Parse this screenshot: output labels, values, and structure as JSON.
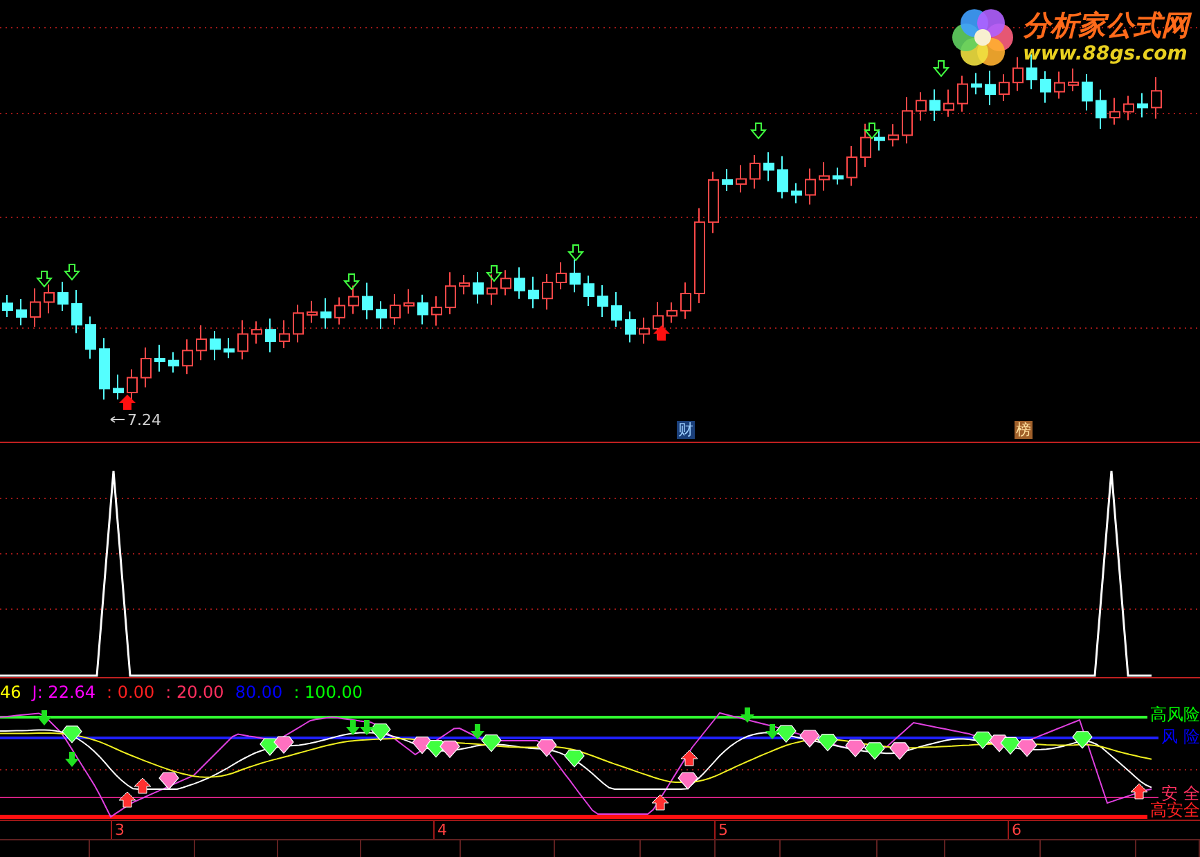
{
  "logo": {
    "title": "分析家公式网",
    "url": "www.88gs.com"
  },
  "price_panel": {
    "low_label": "7.24",
    "markers": [
      {
        "text": "财",
        "kind": "finance"
      },
      {
        "text": "榜",
        "kind": "ranking"
      }
    ]
  },
  "indicator_header": [
    {
      "text": "46",
      "color": "#ffff00"
    },
    {
      "text": "J: 22.64",
      "color": "#ff00ff"
    },
    {
      "text": ": 0.00",
      "color": "#ff2020"
    },
    {
      "text": ": 20.00",
      "color": "#ff3060"
    },
    {
      "text": "80.00",
      "color": "#0000ff"
    },
    {
      "text": ": 100.00",
      "color": "#00ff00"
    }
  ],
  "zone_labels": [
    {
      "text": "高风险",
      "color": "#00ff00"
    },
    {
      "text": "风 险",
      "color": "#0000ff"
    },
    {
      "text": "安 全",
      "color": "#ff3060"
    },
    {
      "text": "高安全",
      "color": "#ff2020"
    }
  ],
  "axis_labels": [
    "3",
    "4",
    "5",
    "6"
  ]
}
